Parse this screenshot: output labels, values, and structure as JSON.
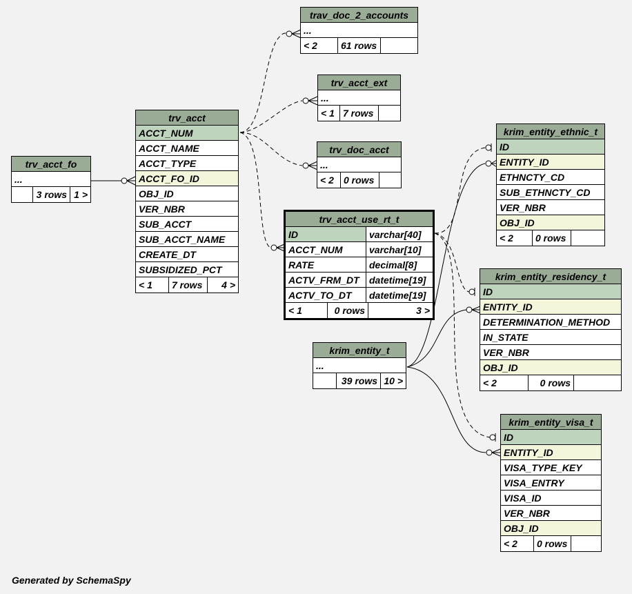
{
  "tables": {
    "trav_doc_2_accounts": {
      "name": "trav_doc_2_accounts",
      "rows": [
        "..."
      ],
      "stats": {
        "parents": "< 2",
        "rows": "61 rows",
        "children": ""
      }
    },
    "trv_acct_ext": {
      "name": "trv_acct_ext",
      "rows": [
        "..."
      ],
      "stats": {
        "parents": "< 1",
        "rows": "7 rows",
        "children": ""
      }
    },
    "trv_doc_acct": {
      "name": "trv_doc_acct",
      "rows": [
        "..."
      ],
      "stats": {
        "parents": "< 2",
        "rows": "0 rows",
        "children": ""
      }
    },
    "trv_acct": {
      "name": "trv_acct",
      "columns": [
        "ACCT_NUM",
        "ACCT_NAME",
        "ACCT_TYPE",
        "ACCT_FO_ID",
        "OBJ_ID",
        "VER_NBR",
        "SUB_ACCT",
        "SUB_ACCT_NAME",
        "CREATE_DT",
        "SUBSIDIZED_PCT"
      ],
      "stats": {
        "parents": "< 1",
        "rows": "7 rows",
        "children": "4 >"
      }
    },
    "trv_acct_fo": {
      "name": "trv_acct_fo",
      "rows": [
        "..."
      ],
      "stats": {
        "parents": "",
        "rows": "3 rows",
        "children": "1 >"
      }
    },
    "trv_acct_use_rt_t": {
      "name": "trv_acct_use_rt_t",
      "columns": [
        {
          "name": "ID",
          "type": "varchar[40]"
        },
        {
          "name": "ACCT_NUM",
          "type": "varchar[10]"
        },
        {
          "name": "RATE",
          "type": "decimal[8]"
        },
        {
          "name": "ACTV_FRM_DT",
          "type": "datetime[19]"
        },
        {
          "name": "ACTV_TO_DT",
          "type": "datetime[19]"
        }
      ],
      "stats": {
        "parents": "< 1",
        "rows": "0 rows",
        "children": "3 >"
      }
    },
    "krim_entity_t": {
      "name": "krim_entity_t",
      "rows": [
        "..."
      ],
      "stats": {
        "parents": "",
        "rows": "39 rows",
        "children": "10 >"
      }
    },
    "krim_entity_ethnic_t": {
      "name": "krim_entity_ethnic_t",
      "columns": [
        "ID",
        "ENTITY_ID",
        "ETHNCTY_CD",
        "SUB_ETHNCTY_CD",
        "VER_NBR",
        "OBJ_ID"
      ],
      "stats": {
        "parents": "< 2",
        "rows": "0 rows",
        "children": ""
      }
    },
    "krim_entity_residency_t": {
      "name": "krim_entity_residency_t",
      "columns": [
        "ID",
        "ENTITY_ID",
        "DETERMINATION_METHOD",
        "IN_STATE",
        "VER_NBR",
        "OBJ_ID"
      ],
      "stats": {
        "parents": "< 2",
        "rows": "0 rows",
        "children": ""
      }
    },
    "krim_entity_visa_t": {
      "name": "krim_entity_visa_t",
      "columns": [
        "ID",
        "ENTITY_ID",
        "VISA_TYPE_KEY",
        "VISA_ENTRY",
        "VISA_ID",
        "VER_NBR",
        "OBJ_ID"
      ],
      "stats": {
        "parents": "< 2",
        "rows": "0 rows",
        "children": ""
      }
    }
  },
  "colors": {
    "title_bg": "#9aab96",
    "pk_bg": "#bfd4bc",
    "fk_bg": "#f4f6dc",
    "page_bg": "#f2f2f2"
  },
  "footer": "Generated by SchemaSpy"
}
